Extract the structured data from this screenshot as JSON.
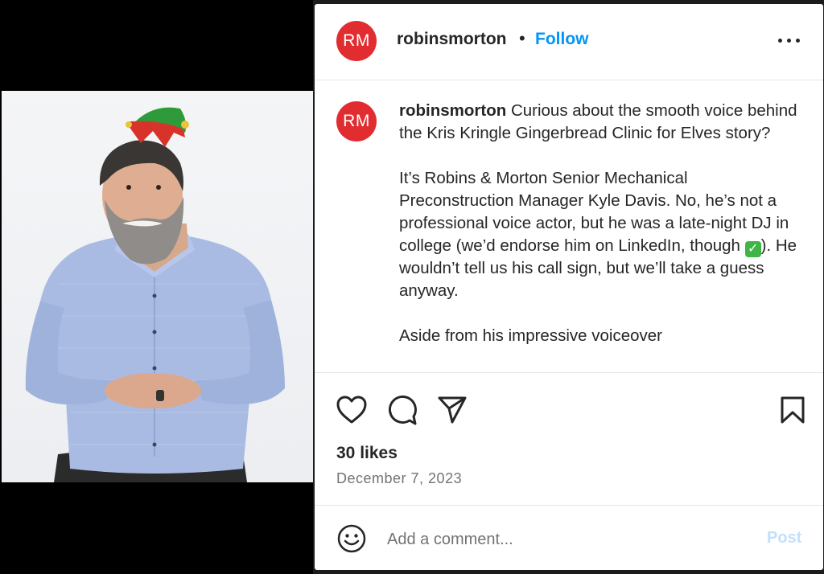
{
  "post": {
    "username": "robinsmorton",
    "avatar_initials": "RM",
    "separator": "•",
    "follow_label": "Follow",
    "more_icon": "more-options-icon"
  },
  "caption": {
    "username": "robinsmorton",
    "p1_text": " Curious about the smooth voice behind the Kris Kringle Gingerbread Clinic for Elves story?",
    "p2_before": "It’s Robins & Morton Senior Mechanical Preconstruction Manager Kyle Davis. No, he’s not a professional voice actor, but he was a late-night DJ in college (we’d endorse him on LinkedIn, though ",
    "p2_check": "✓",
    "p2_after": "). He wouldn’t tell us his call sign, but we’ll take a guess anyway.",
    "p3_text": "Aside from his impressive voiceover"
  },
  "actions": {
    "likes": "30 likes",
    "date": "December 7, 2023",
    "icons": [
      "heart-icon",
      "comment-icon",
      "share-icon",
      "bookmark-icon"
    ]
  },
  "comment": {
    "placeholder": "Add a comment...",
    "post_label": "Post",
    "emoji_icon": "emoji-icon"
  },
  "colors": {
    "avatar": "#e12d2f",
    "follow": "#0095f6",
    "post_disabled": "#c2e0fd",
    "shirt": "#a8b9e0"
  }
}
